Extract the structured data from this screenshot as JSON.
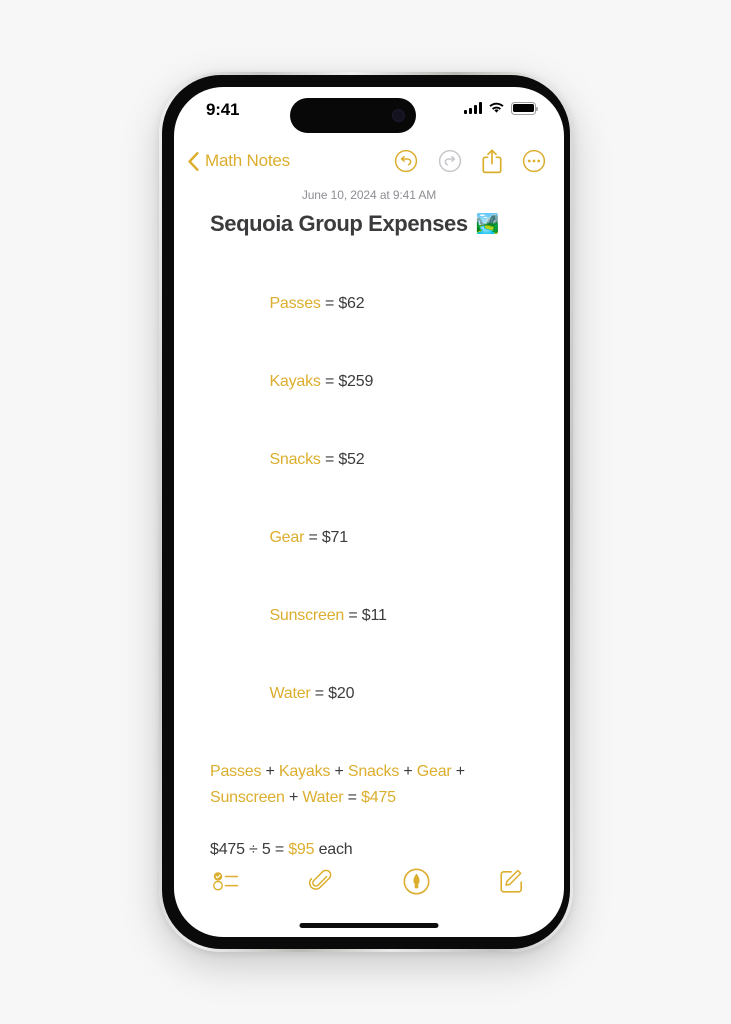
{
  "device": {
    "status_bar": {
      "time": "9:41",
      "cellular_icon": "cellular-signal-icon",
      "wifi_icon": "wifi-icon",
      "battery_icon": "battery-full-icon"
    },
    "home_indicator": "home-indicator"
  },
  "nav": {
    "back_label": "Math Notes",
    "back_icon": "chevron-left-icon",
    "actions": [
      {
        "name": "undo-button",
        "icon": "undo-icon",
        "state": "enabled"
      },
      {
        "name": "redo-button",
        "icon": "redo-icon",
        "state": "disabled"
      },
      {
        "name": "share-button",
        "icon": "share-icon",
        "state": "enabled"
      },
      {
        "name": "more-button",
        "icon": "ellipsis-circle-icon",
        "state": "enabled"
      }
    ]
  },
  "note": {
    "date": "June 10, 2024 at 9:41 AM",
    "title": "Sequoia Group Expenses",
    "title_emoji": "🏞️",
    "variables": [
      {
        "name": "Passes",
        "eq": " = ",
        "value": "$62"
      },
      {
        "name": "Kayaks",
        "eq": " = ",
        "value": "$259"
      },
      {
        "name": "Snacks",
        "eq": " = ",
        "value": "$52"
      },
      {
        "name": "Gear",
        "eq": " = ",
        "value": "$71"
      },
      {
        "name": "Sunscreen",
        "eq": " = ",
        "value": "$11"
      },
      {
        "name": "Water",
        "eq": " = ",
        "value": "$20"
      }
    ],
    "sum_expression": {
      "terms": [
        "Passes",
        "Kayaks",
        "Snacks",
        "Gear",
        "Sunscreen",
        "Water"
      ],
      "operator": " + ",
      "equals": " = ",
      "result": "$475"
    },
    "final_line": {
      "dividend": "$475",
      "divide_symbol": " ÷ ",
      "divisor": "5",
      "equals": " = ",
      "result": "$95",
      "suffix": " each"
    }
  },
  "toolbar": {
    "items": [
      {
        "name": "checklist-button",
        "icon": "checklist-icon"
      },
      {
        "name": "attachment-button",
        "icon": "paperclip-icon"
      },
      {
        "name": "markup-button",
        "icon": "markup-pen-icon"
      },
      {
        "name": "compose-button",
        "icon": "compose-icon"
      }
    ]
  },
  "colors": {
    "accent_yellow": "#dcae2e",
    "disabled_gray": "#c7c7cc",
    "text_dark": "#3b3b3d",
    "date_gray": "#8e8e93",
    "page_background": "#f7f7f7",
    "screen_background": "#ffffff"
  }
}
